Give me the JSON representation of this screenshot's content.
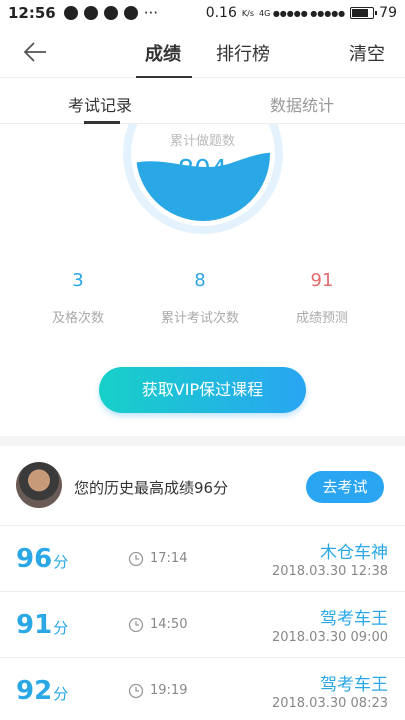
{
  "status_bar": {
    "time": "12:56",
    "speed": "0.16",
    "speed_unit": "K/s",
    "signal": "4G ●●●●● ●●●●●",
    "battery": "79",
    "battery_level": 0.79
  },
  "nav": {
    "tab_score": "成绩",
    "tab_ranking": "排行榜",
    "clear": "清空"
  },
  "subtabs": {
    "records": "考试记录",
    "statistics": "数据统计"
  },
  "gauge": {
    "label": "累计做题数",
    "value": "804",
    "fill_level": 0.45,
    "color": "#2aa8e6"
  },
  "stats": [
    {
      "value": "3",
      "label": "及格次数"
    },
    {
      "value": "8",
      "label": "累计考试次数"
    },
    {
      "value": "91",
      "label": "成绩预测"
    }
  ],
  "vip_button": "获取VIP保过课程",
  "best": {
    "text": "您的历史最高成绩96分",
    "button": "去考试"
  },
  "records": [
    {
      "score": "96",
      "unit": "分",
      "duration": "17:14",
      "title": "木仓车神",
      "date": "2018.03.30  12:38"
    },
    {
      "score": "91",
      "unit": "分",
      "duration": "14:50",
      "title": "驾考车王",
      "date": "2018.03.30  09:00"
    },
    {
      "score": "92",
      "unit": "分",
      "duration": "19:19",
      "title": "驾考车王",
      "date": "2018.03.30  08:23"
    }
  ],
  "colors": {
    "accent": "#2aa8e6",
    "prediction": "#e46b6b",
    "button_start": "#17d0c8",
    "button_end": "#29a5f2"
  }
}
